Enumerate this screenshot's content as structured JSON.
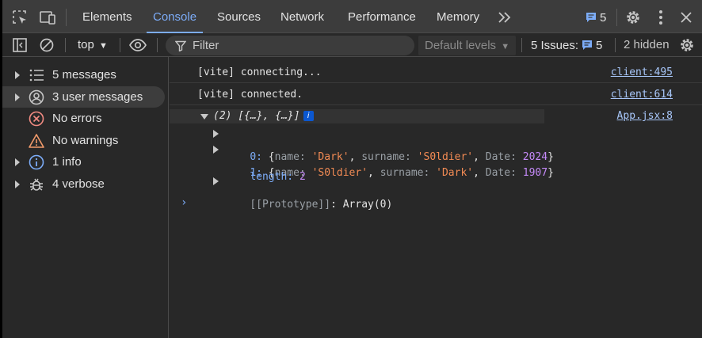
{
  "tabs": [
    {
      "label": "Elements",
      "active": false
    },
    {
      "label": "Console",
      "active": true
    },
    {
      "label": "Sources",
      "active": false
    },
    {
      "label": "Network",
      "active": false
    },
    {
      "label": "Performance",
      "active": false
    },
    {
      "label": "Memory",
      "active": false
    }
  ],
  "topbar": {
    "issues_count": "5"
  },
  "toolbar": {
    "context": "top",
    "filter_placeholder": "Filter",
    "levels": "Default levels",
    "issues_label": "5 Issues:",
    "issues_count": "5",
    "hidden": "2 hidden"
  },
  "sidebar": {
    "items": [
      {
        "label": "5 messages",
        "icon": "list-icon"
      },
      {
        "label": "3 user messages",
        "icon": "user-icon"
      },
      {
        "label": "No errors",
        "icon": "error-icon"
      },
      {
        "label": "No warnings",
        "icon": "warning-icon"
      },
      {
        "label": "1 info",
        "icon": "info-icon"
      },
      {
        "label": "4 verbose",
        "icon": "bug-icon"
      }
    ]
  },
  "console": {
    "messages": [
      {
        "text": "[vite] connecting...",
        "source": "client:495"
      },
      {
        "text": "[vite] connected.",
        "source": "client:614"
      }
    ],
    "group": {
      "summary": "(2) [{…}, {…}]",
      "info_badge": "i",
      "source": "App.jsx:8",
      "items": [
        {
          "index": "0",
          "name": "'Dark'",
          "surname": "'S0ldier'",
          "date": "2024"
        },
        {
          "index": "1",
          "name": "'S0ldier'",
          "surname": "'Dark'",
          "date": "1907"
        }
      ],
      "length_key": "length",
      "length_value": "2",
      "prototype_key": "[[Prototype]]",
      "prototype_value": "Array(0)"
    },
    "prompt": "›"
  },
  "colors": {
    "accent": "#7cacf8",
    "link": "#a8c7fa",
    "string": "#f28b54",
    "number": "#c58af9"
  }
}
